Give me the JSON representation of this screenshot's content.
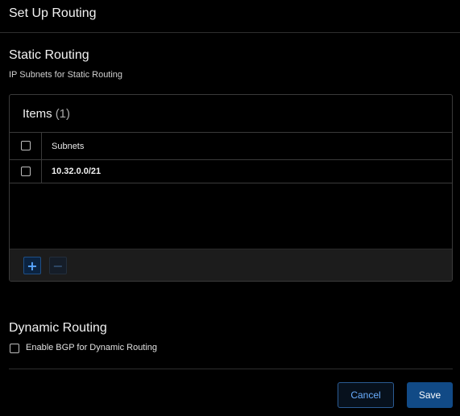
{
  "dialog": {
    "title": "Set Up Routing"
  },
  "static_routing": {
    "title": "Static Routing",
    "subtitle": "IP Subnets for Static Routing",
    "items_label": "Items",
    "items_count": "(1)",
    "columns": [
      "Subnets"
    ],
    "rows": [
      {
        "subnet": "10.32.0.0/21",
        "checked": false
      }
    ],
    "add_icon": "plus-icon",
    "remove_icon": "minus-icon"
  },
  "dynamic_routing": {
    "title": "Dynamic Routing",
    "bgp_label": "Enable BGP for Dynamic Routing",
    "bgp_checked": false
  },
  "footer": {
    "cancel_label": "Cancel",
    "save_label": "Save"
  },
  "colors": {
    "accent": "#114a86",
    "link": "#6aaeff",
    "background": "#000000"
  }
}
